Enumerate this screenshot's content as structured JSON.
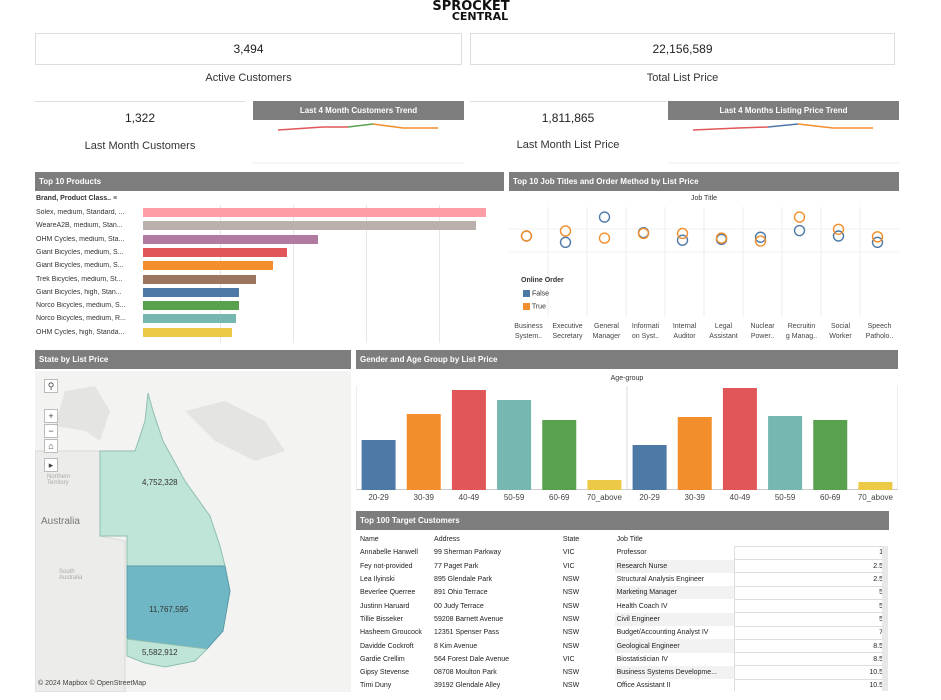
{
  "logo": {
    "line1": "SPROCKET",
    "line2": "CENTRAL"
  },
  "kpis": {
    "active_customers": {
      "value": "3,494",
      "label": "Active Customers"
    },
    "total_list_price": {
      "value": "22,156,589",
      "label": "Total List Price"
    },
    "last_month_customers": {
      "value": "1,322",
      "label": "Last Month Customers"
    },
    "last_month_list_price": {
      "value": "1,811,865",
      "label": "Last Month List Price"
    }
  },
  "trends": {
    "customers_title": "Last 4 Month Customers Trend",
    "listing_title": "Last 4 Months Listing Price Trend"
  },
  "top_products": {
    "title": "Top 10 Products",
    "column_header": "Brand, Product Class..",
    "items": [
      {
        "label": "Solex, medium, Standard, ...",
        "value": 1.0,
        "color": "#ff9da7"
      },
      {
        "label": "WeareA2B, medium, Stan...",
        "value": 0.97,
        "color": "#bab0ac"
      },
      {
        "label": "OHM Cycles, medium, Sta...",
        "value": 0.51,
        "color": "#b07aa1"
      },
      {
        "label": "Giant Bicycles, medium, S...",
        "value": 0.42,
        "color": "#e15759"
      },
      {
        "label": "Giant Bicycles, medium, S...",
        "value": 0.38,
        "color": "#f28e2b"
      },
      {
        "label": "Trek Bicycles, medium, St...",
        "value": 0.33,
        "color": "#9c755f"
      },
      {
        "label": "Giant Bicycles, high, Stan...",
        "value": 0.28,
        "color": "#4e79a7"
      },
      {
        "label": "Norco Bicycles, medium, S...",
        "value": 0.28,
        "color": "#59a14f"
      },
      {
        "label": "Norco Bicycles, medium, R...",
        "value": 0.27,
        "color": "#76b7b2"
      },
      {
        "label": "OHM Cycles, high, Standa...",
        "value": 0.26,
        "color": "#edc948"
      }
    ]
  },
  "job_titles": {
    "title": "Top 10 Job Titles and Order Method by List Price",
    "axis_title": "Job Title",
    "legend_title": "Online Order",
    "legend": [
      {
        "label": "False",
        "color": "#4e79a7"
      },
      {
        "label": "True",
        "color": "#f28e2b"
      }
    ],
    "categories": [
      {
        "l1": "Business",
        "l2": "System..",
        "false": 0.5,
        "true": 0.5
      },
      {
        "l1": "Executive",
        "l2": "Secretary",
        "false": 0.35,
        "true": 0.62
      },
      {
        "l1": "General",
        "l2": "Manager",
        "false": 0.95,
        "true": 0.45
      },
      {
        "l1": "Informati",
        "l2": "on Syst..",
        "false": 0.58,
        "true": 0.56
      },
      {
        "l1": "Internal",
        "l2": "Auditor",
        "false": 0.4,
        "true": 0.56
      },
      {
        "l1": "Legal",
        "l2": "Assistant",
        "false": 0.42,
        "true": 0.45
      },
      {
        "l1": "Nuclear",
        "l2": "Power..",
        "false": 0.47,
        "true": 0.38
      },
      {
        "l1": "Recruitin",
        "l2": "g Manag..",
        "false": 0.63,
        "true": 0.95
      },
      {
        "l1": "Social",
        "l2": "Worker",
        "false": 0.5,
        "true": 0.66
      },
      {
        "l1": "Speech",
        "l2": "Patholo..",
        "false": 0.35,
        "true": 0.48
      }
    ]
  },
  "state_map": {
    "title": "State by List Price",
    "labels": {
      "qld": "4,752,328",
      "nsw": "11,767,595",
      "vic": "5,582,912"
    },
    "country": "Australia",
    "nt": "Northern Territory",
    "sa": "South Australia",
    "attribution": "© 2024 Mapbox © OpenStreetMap"
  },
  "gender_age": {
    "title": "Gender and Age Group by List Price",
    "axis_title": "Age-group",
    "categories": [
      "20-29",
      "30-39",
      "40-49",
      "50-59",
      "60-69",
      "70_above"
    ],
    "colors": [
      "#4e79a7",
      "#f28e2b",
      "#e15759",
      "#76b7b2",
      "#59a14f",
      "#edc948"
    ],
    "panels": [
      {
        "values": [
          0.5,
          0.76,
          1.0,
          0.9,
          0.7,
          0.1
        ]
      },
      {
        "values": [
          0.45,
          0.73,
          1.02,
          0.74,
          0.7,
          0.08
        ]
      }
    ]
  },
  "target_customers": {
    "title": "Top 100 Target Customers",
    "headers": [
      "Name",
      "Address",
      "State",
      "Job Title"
    ],
    "rows": [
      [
        "Annabelle Hanwell",
        "99 Sherman Parkway",
        "VIC",
        "Professor",
        "1"
      ],
      [
        "Fey not-provided",
        "77 Paget Park",
        "VIC",
        "Research Nurse",
        "2.5"
      ],
      [
        "Lea Ilyinski",
        "895 Glendale Park",
        "NSW",
        "Structural Analysis Engineer",
        "2.5"
      ],
      [
        "Beverlee Querree",
        "891 Ohio Terrace",
        "NSW",
        "Marketing Manager",
        "5"
      ],
      [
        "Justinn Haruard",
        "00 Judy Terrace",
        "NSW",
        "Health Coach IV",
        "5"
      ],
      [
        "Tillie Bisseker",
        "59208 Barnett Avenue",
        "NSW",
        "Civil Engineer",
        "5"
      ],
      [
        "Hasheem Groucock",
        "12351 Spenser Pass",
        "NSW",
        "Budget/Accounting Analyst IV",
        "7"
      ],
      [
        "Davidde Cockroft",
        "8 Kim Avenue",
        "NSW",
        "Geological Engineer",
        "8.5"
      ],
      [
        "Gardie Crellim",
        "564 Forest Dale Avenue",
        "VIC",
        "Biostatistician IV",
        "8.5"
      ],
      [
        "Gipsy Stevense",
        "08708 Moulton Park",
        "NSW",
        "Business Systems Developme...",
        "10.5"
      ],
      [
        "Timi Duny",
        "39192 Glendale Alley",
        "NSW",
        "Office Assistant II",
        "10.5"
      ]
    ]
  }
}
